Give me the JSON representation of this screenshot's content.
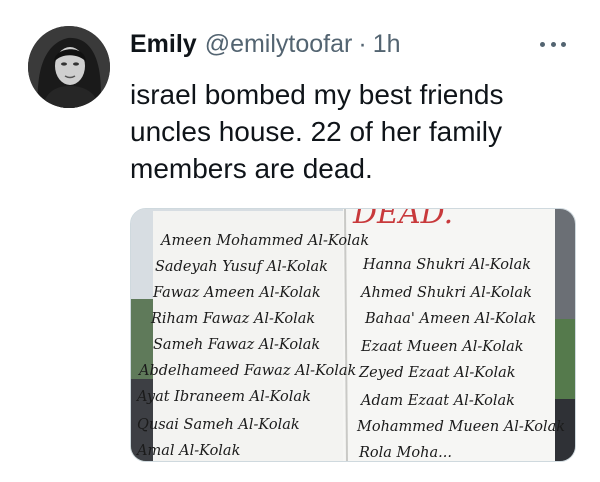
{
  "tweet": {
    "author": {
      "name": "Emily",
      "handle": "@emilytoofar"
    },
    "separator": "·",
    "time": "1h",
    "more_icon": "more-horizontal-icon",
    "text_lines": [
      "israel bombed my best friends",
      "uncles house. 22 of her family",
      "members are dead."
    ],
    "media": {
      "header_text": "DEAD.",
      "left_column": [
        "Ameen Mohammed Al-Kolak",
        "Sadeyah Yusuf Al-Kolak",
        "Fawaz Ameen Al-Kolak",
        "Riham Fawaz Al-Kolak",
        "Sameh Fawaz Al-Kolak",
        "Abdelhameed Fawaz Al-Kolak",
        "Ayat Ibraneem Al-Kolak",
        "Qusai Sameh Al-Kolak",
        "Amal Al-Kolak"
      ],
      "right_column": [
        "Hanna Shukri Al-Kolak",
        "Ahmed Shukri Al-Kolak",
        "Bahaa' Ameen Al-Kolak",
        "Ezaat Mueen Al-Kolak",
        "Zeyed Ezaat Al-Kolak",
        "Adam Ezaat Al-Kolak",
        "Mohammed Mueen Al-Kolak",
        "Rola Moha..."
      ]
    }
  }
}
